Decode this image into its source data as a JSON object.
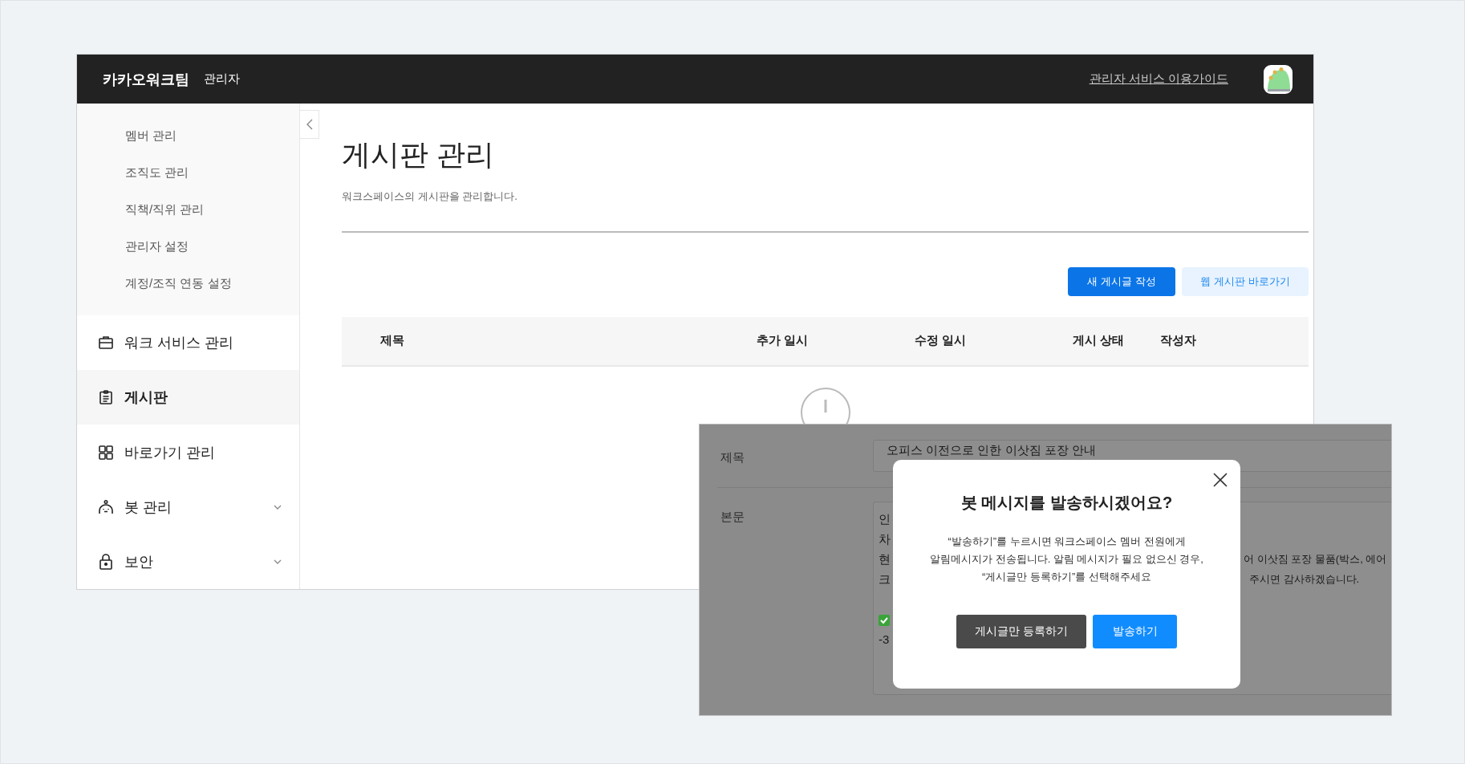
{
  "header": {
    "logo": "카카오워크팀",
    "role": "관리자",
    "guide_link": "관리자 서비스 이용가이드"
  },
  "sidebar": {
    "sub_items": [
      {
        "label": "멤버 관리"
      },
      {
        "label": "조직도 관리"
      },
      {
        "label": "직책/직위 관리"
      },
      {
        "label": "관리자 설정"
      },
      {
        "label": "계정/조직 연동 설정"
      }
    ],
    "items": [
      {
        "label": "워크 서비스 관리",
        "kind": "briefcase",
        "selected": false,
        "has_submenu": false
      },
      {
        "label": "게시판",
        "kind": "clipboard",
        "selected": true,
        "has_submenu": false
      },
      {
        "label": "바로가기 관리",
        "kind": "grid",
        "selected": false,
        "has_submenu": false
      },
      {
        "label": "봇 관리",
        "kind": "bot",
        "selected": false,
        "has_submenu": true
      },
      {
        "label": "보안",
        "kind": "lock",
        "selected": false,
        "has_submenu": true
      }
    ]
  },
  "page": {
    "title": "게시판 관리",
    "description": "워크스페이스의 게시판을 관리합니다.",
    "buttons": [
      {
        "label": "새 게시글 작성",
        "kind": "primary"
      },
      {
        "label": "웹 게시판 바로가기",
        "kind": "secondary"
      }
    ],
    "table": {
      "columns": [
        "제목",
        "추가 일시",
        "수정 일시",
        "게시 상태",
        "작성자"
      ]
    }
  },
  "editor": {
    "title_label": "제목",
    "title_value": "오피스 이전으로 인한 이삿짐 포장 안내",
    "body_label": "본문",
    "body_left": [
      "인",
      "차",
      "현",
      "크"
    ],
    "body_right": [
      "어 이삿짐 포장 물품(박스, 에어",
      "주시면 감사하겠습니다."
    ],
    "after_check": "-3"
  },
  "dialog": {
    "title": "봇 메시지를 발송하시겠어요?",
    "message": "“발송하기”를 누르시면 워크스페이스 멤버 전원에게\n알림메시지가 전송됩니다. 알림 메시지가 필요 없으신 경우,\n“게시글만 등록하기”를 선택해주세요",
    "buttons": [
      {
        "label": "게시글만 등록하기",
        "kind": "secondary"
      },
      {
        "label": "발송하기",
        "kind": "primary"
      }
    ]
  }
}
